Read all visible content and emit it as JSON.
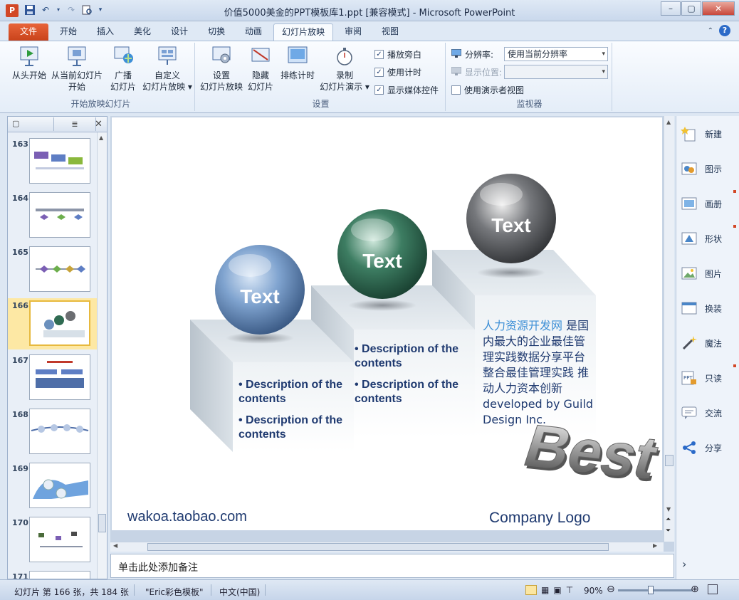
{
  "window": {
    "title": "价值5000美金的PPT模板库1.ppt [兼容模式]  -  Microsoft PowerPoint",
    "app_icon_letter": "P"
  },
  "ribbon_tabs": [
    "文件",
    "开始",
    "插入",
    "美化",
    "设计",
    "切换",
    "动画",
    "幻灯片放映",
    "审阅",
    "视图"
  ],
  "active_tab": "幻灯片放映",
  "ribbon": {
    "group_start": {
      "label": "开始放映幻灯片",
      "from_start": "从头开始",
      "from_current_1": "从当前幻灯片",
      "from_current_2": "开始",
      "broadcast_1": "广播",
      "broadcast_2": "幻灯片",
      "custom_1": "自定义",
      "custom_2": "幻灯片放映 ▾"
    },
    "group_setup": {
      "label": "设置",
      "setup_1": "设置",
      "setup_2": "幻灯片放映",
      "hide_1": "隐藏",
      "hide_2": "幻灯片",
      "rehearse": "排练计时",
      "record_1": "录制",
      "record_2": "幻灯片演示 ▾",
      "chk_narration": "播放旁白",
      "chk_timing": "使用计时",
      "chk_media": "显示媒体控件"
    },
    "group_monitor": {
      "label": "监视器",
      "resolution_label": "分辨率:",
      "resolution_value": "使用当前分辨率",
      "show_on_label": "显示位置:",
      "presenter_view": "使用演示者视图"
    }
  },
  "thumbnails": [
    {
      "num": "163"
    },
    {
      "num": "164"
    },
    {
      "num": "165"
    },
    {
      "num": "166"
    },
    {
      "num": "167"
    },
    {
      "num": "168"
    },
    {
      "num": "169"
    },
    {
      "num": "170"
    },
    {
      "num": "171"
    }
  ],
  "slide": {
    "sphere_left": "Text",
    "sphere_mid": "Text",
    "sphere_right": "Text",
    "left_bullet_1": "• Description of the contents",
    "left_bullet_2": "• Description of the contents",
    "mid_bullet_1": "• Description of the contents",
    "mid_bullet_2": "• Description of the contents",
    "right_text_highlight": "人力资源开发网",
    "right_text_body": " 是国内最大的企业最佳管理实践数据分享平台 整合最佳管理实践 推动人力资本创新developed by Guild Design Inc.",
    "best_text": "Best",
    "footer_left": "wakoa.taobao.com",
    "footer_right": "Company Logo"
  },
  "notes_placeholder": "单击此处添加备注",
  "side_panel": [
    "新建",
    "图示",
    "画册",
    "形状",
    "图片",
    "换装",
    "魔法",
    "只读",
    "交流",
    "分享"
  ],
  "status": {
    "slide_info": "幻灯片 第 166 张，共 184 张",
    "theme": "\"Eric彩色模板\"",
    "language": "中文(中国)",
    "zoom": "90%",
    "zoom_level_percent": 90
  },
  "colors": {
    "file_tab": "#d24726",
    "sphere_blue": "#5e84b3",
    "sphere_green": "#2f6b52",
    "sphere_gray": "#5d5f63",
    "bullet_text": "#1f3a70",
    "link_blue": "#3d8fd6"
  }
}
